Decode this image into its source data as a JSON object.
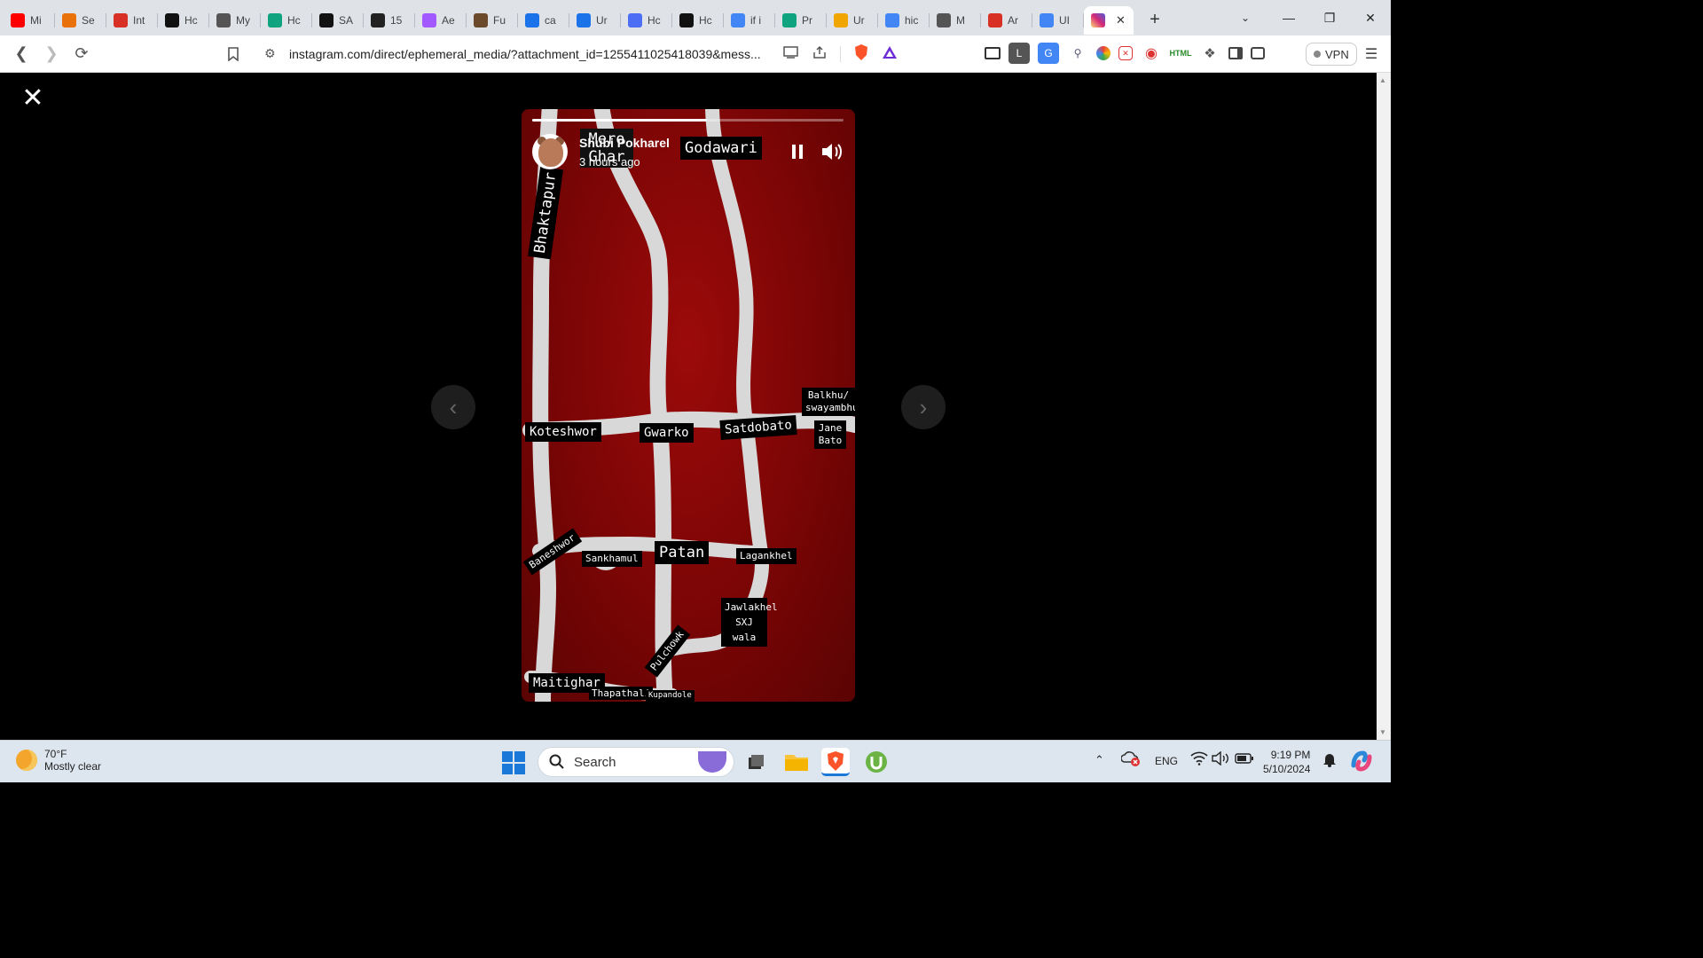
{
  "browser": {
    "tabs": [
      {
        "label": "Mi",
        "icon": "youtube-icon",
        "color": "#ff0000"
      },
      {
        "label": "Se",
        "icon": "puzzle-icon",
        "color": "#e8710a"
      },
      {
        "label": "Int",
        "icon": "gmail-icon",
        "color": "#d93025"
      },
      {
        "label": "Hc",
        "icon": "threads-icon",
        "color": "#111111"
      },
      {
        "label": "My",
        "icon": "globe-icon",
        "color": "#555555"
      },
      {
        "label": "Hc",
        "icon": "chatgpt-icon",
        "color": "#10a37f"
      },
      {
        "label": "SA",
        "icon": "terminal-icon",
        "color": "#111111"
      },
      {
        "label": "15",
        "icon": "code-icon",
        "color": "#222222"
      },
      {
        "label": "Ae",
        "icon": "figma-icon",
        "color": "#a259ff"
      },
      {
        "label": "Fu",
        "icon": "avatar-icon",
        "color": "#6b4a2b"
      },
      {
        "label": "ca",
        "icon": "c-icon",
        "color": "#1a73e8"
      },
      {
        "label": "Ur",
        "icon": "c-icon",
        "color": "#1a73e8"
      },
      {
        "label": "Hc",
        "icon": "calendar-icon",
        "color": "#4c6ef5"
      },
      {
        "label": "Hc",
        "icon": "threads-icon",
        "color": "#111111"
      },
      {
        "label": "if i",
        "icon": "google-icon",
        "color": "#4285f4"
      },
      {
        "label": "Pr",
        "icon": "chatgpt-icon",
        "color": "#10a37f"
      },
      {
        "label": "Ur",
        "icon": "book-icon",
        "color": "#f0a500"
      },
      {
        "label": "hic",
        "icon": "google-icon",
        "color": "#4285f4"
      },
      {
        "label": "M",
        "icon": "globe-icon",
        "color": "#555555"
      },
      {
        "label": "Ar",
        "icon": "gmail-icon",
        "color": "#d93025"
      },
      {
        "label": "UI",
        "icon": "google-icon",
        "color": "#4285f4"
      },
      {
        "label": "",
        "icon": "instagram-icon",
        "color": "#e1306c",
        "active": true
      }
    ],
    "close_tab": "✕",
    "new_tab": "+",
    "url": "instagram.com/direct/ephemeral_media/?attachment_id=1255411025418039&mess...",
    "vpn_label": "VPN"
  },
  "story": {
    "username": "Shubi Pokharel",
    "time_ago": "3 hours ago",
    "progress": 0.56,
    "map_labels": {
      "mero_ghar": "Mero Ghar",
      "godawari": "Godawari",
      "bhaktapur": "Bhaktapur",
      "balkhu": "Balkhu/ swayambhu",
      "jane_bato": "Jane Bato",
      "koteshwor": "Koteshwor",
      "gwarko": "Gwarko",
      "satdobato": "Satdobato",
      "baneshwor": "Baneshwor",
      "sankhamul": "Sankhamul",
      "patan": "Patan",
      "lagankhel": "Lagankhel",
      "jawlakhel": "Jawlakhel SXJ wala",
      "pulchowk": "Pulchowk",
      "maitighar": "Maitighar",
      "thapathali": "Thapathali",
      "kupandole": "Kupandole"
    }
  },
  "taskbar": {
    "temperature": "70°F",
    "weather": "Mostly clear",
    "search_placeholder": "Search",
    "lang": "ENG",
    "time": "9:19 PM",
    "date": "5/10/2024"
  }
}
